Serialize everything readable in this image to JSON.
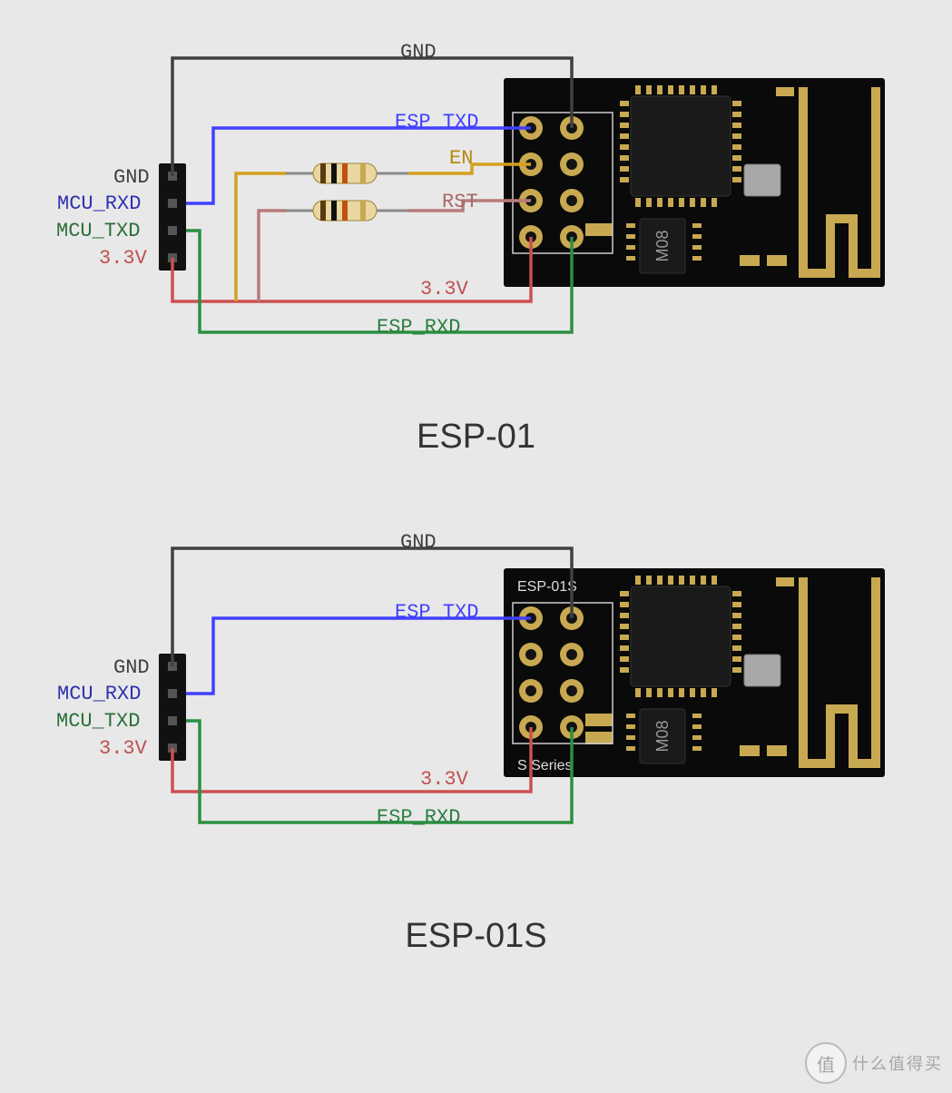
{
  "diagrams": {
    "top": {
      "title": "ESP-01",
      "labels": {
        "gnd_top": "GND",
        "esp_txd": "ESP_TXD",
        "en": "EN",
        "rst": "RST",
        "vcc_wire": "3.3V",
        "esp_rxd": "ESP_RXD"
      },
      "header": {
        "gnd": "GND",
        "mcu_rxd": "MCU_RXD",
        "mcu_txd": "MCU_TXD",
        "vcc": "3.3V"
      },
      "chip_marking": "M08"
    },
    "bottom": {
      "title": "ESP-01S",
      "board_text_top": "ESP-01S",
      "board_text_bottom": "S Series",
      "labels": {
        "gnd_top": "GND",
        "esp_txd": "ESP_TXD",
        "vcc_wire": "3.3V",
        "esp_rxd": "ESP_RXD"
      },
      "header": {
        "gnd": "GND",
        "mcu_rxd": "MCU_RXD",
        "mcu_txd": "MCU_TXD",
        "vcc": "3.3V"
      },
      "chip_marking": "M08"
    }
  },
  "colors": {
    "gnd": "#404040",
    "txd": "#4040ff",
    "en": "#d4a020",
    "rst": "#b97a7a",
    "vcc": "#cc5050",
    "rxd": "#2a9040"
  },
  "watermark": {
    "circle": "值",
    "text": "什么值得买"
  }
}
